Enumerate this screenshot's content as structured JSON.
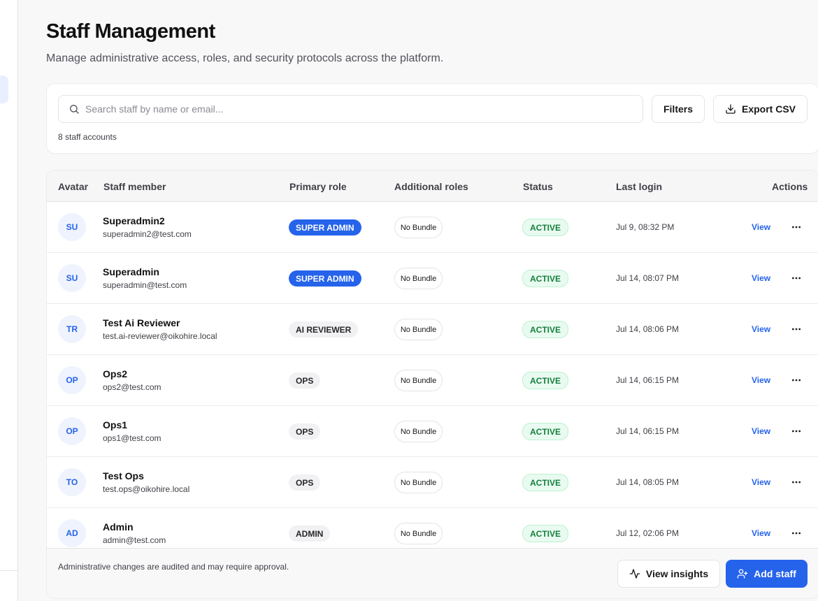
{
  "header": {
    "title": "Staff Management",
    "subtitle": "Manage administrative access, roles, and security protocols across the platform."
  },
  "toolbar": {
    "search_placeholder": "Search staff by name or email...",
    "search_value": "",
    "filters_label": "Filters",
    "export_label": "Export CSV",
    "count_text": "8 staff accounts"
  },
  "table": {
    "columns": {
      "avatar": "Avatar",
      "member": "Staff member",
      "primary_role": "Primary role",
      "additional_roles": "Additional roles",
      "status": "Status",
      "last_login": "Last login",
      "actions": "Actions"
    },
    "view_label": "View",
    "rows": [
      {
        "initials": "SU",
        "name": "Superadmin2",
        "email": "superadmin2@test.com",
        "role": "SUPER ADMIN",
        "role_style": "primary",
        "bundle": "No Bundle",
        "status": "ACTIVE",
        "last_login": "Jul 9, 08:32 PM"
      },
      {
        "initials": "SU",
        "name": "Superadmin",
        "email": "superadmin@test.com",
        "role": "SUPER ADMIN",
        "role_style": "primary",
        "bundle": "No Bundle",
        "status": "ACTIVE",
        "last_login": "Jul 14, 08:07 PM"
      },
      {
        "initials": "TR",
        "name": "Test Ai Reviewer",
        "email": "test.ai-reviewer@oikohire.local",
        "role": "AI REVIEWER",
        "role_style": "neutral",
        "bundle": "No Bundle",
        "status": "ACTIVE",
        "last_login": "Jul 14, 08:06 PM"
      },
      {
        "initials": "OP",
        "name": "Ops2",
        "email": "ops2@test.com",
        "role": "OPS",
        "role_style": "neutral",
        "bundle": "No Bundle",
        "status": "ACTIVE",
        "last_login": "Jul 14, 06:15 PM"
      },
      {
        "initials": "OP",
        "name": "Ops1",
        "email": "ops1@test.com",
        "role": "OPS",
        "role_style": "neutral",
        "bundle": "No Bundle",
        "status": "ACTIVE",
        "last_login": "Jul 14, 06:15 PM"
      },
      {
        "initials": "TO",
        "name": "Test Ops",
        "email": "test.ops@oikohire.local",
        "role": "OPS",
        "role_style": "neutral",
        "bundle": "No Bundle",
        "status": "ACTIVE",
        "last_login": "Jul 14, 08:05 PM"
      },
      {
        "initials": "AD",
        "name": "Admin",
        "email": "admin@test.com",
        "role": "ADMIN",
        "role_style": "neutral",
        "bundle": "No Bundle",
        "status": "ACTIVE",
        "last_login": "Jul 12, 02:06 PM"
      }
    ]
  },
  "footer": {
    "note": "Administrative changes are audited and may require approval.",
    "insights_label": "View insights",
    "add_label": "Add staff"
  },
  "icons": {
    "search": "search-icon",
    "export": "download-icon",
    "more": "more-horizontal-icon",
    "insights": "activity-icon",
    "add": "user-plus-icon"
  },
  "colors": {
    "accent": "#2563eb",
    "status_active_bg": "#e9fbf0",
    "status_active_text": "#15803d"
  }
}
